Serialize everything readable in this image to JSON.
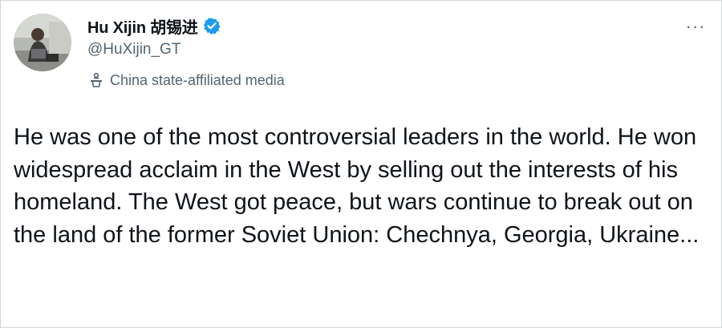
{
  "tweet": {
    "author": {
      "name": "Hu Xijin 胡锡进",
      "handle": "@HuXijin_GT",
      "verified": true,
      "affiliation_label": "China state-affiliated media"
    },
    "icons": {
      "verified": "verified-badge-icon",
      "affiliation": "podium-icon",
      "more": "more-dots-icon"
    },
    "more_glyph": "···",
    "text": "He was one of the most controversial leaders in the world. He won widespread acclaim in the West by selling out the interests of his homeland. The West got peace, but wars continue to break out on the land of the former Soviet Union: Chechnya, Georgia, Ukraine..."
  },
  "colors": {
    "text_primary": "#0f1419",
    "text_secondary": "#536471",
    "verified_blue": "#1d9bf0",
    "border": "#cfd9de"
  }
}
